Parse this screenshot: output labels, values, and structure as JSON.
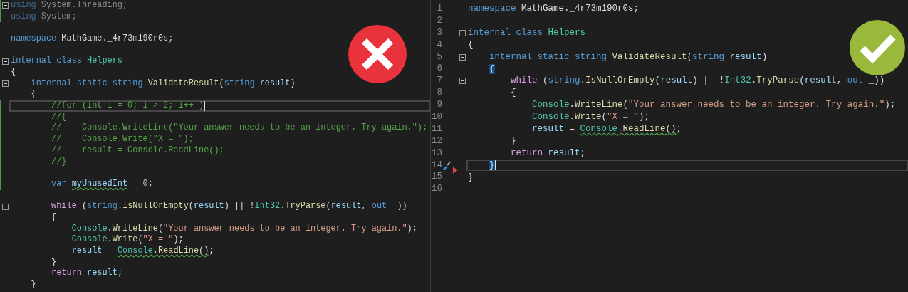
{
  "before": {
    "passed": false,
    "lines": [
      {
        "fold": true,
        "changed": true,
        "tokens": [
          {
            "text": "using",
            "kind": "dim_keyword"
          },
          {
            "text": " System.Threading;",
            "kind": "dim"
          }
        ]
      },
      {
        "changed": true,
        "tokens": [
          {
            "text": "using",
            "kind": "dim_keyword"
          },
          {
            "text": " System;",
            "kind": "dim"
          }
        ]
      },
      {
        "kind": "blank"
      },
      {
        "tokens": [
          {
            "text": "namespace",
            "kind": "keyword"
          },
          {
            "text": " MathGame._4r73m190r0s;",
            "kind": "plain"
          }
        ]
      },
      {
        "kind": "blank"
      },
      {
        "fold": true,
        "tokens": [
          {
            "text": "internal class ",
            "kind": "keyword"
          },
          {
            "text": "Helpers",
            "kind": "type"
          }
        ]
      },
      {
        "tokens": [
          {
            "text": "{",
            "kind": "plain"
          }
        ]
      },
      {
        "fold": true,
        "tokens": [
          {
            "text": "    internal static string ",
            "kind": "keyword"
          },
          {
            "text": "ValidateResult",
            "kind": "method"
          },
          {
            "text": "(",
            "kind": "plain"
          },
          {
            "text": "string ",
            "kind": "keyword"
          },
          {
            "text": "result",
            "kind": "variable"
          },
          {
            "text": ")",
            "kind": "plain"
          }
        ]
      },
      {
        "tokens": [
          {
            "text": "    {",
            "kind": "plain"
          }
        ]
      },
      {
        "current": true,
        "changed": true,
        "tokens": [
          {
            "text": "        //for (int i = 0; i > 2; i++ )",
            "kind": "comment"
          }
        ]
      },
      {
        "changed": true,
        "tokens": [
          {
            "text": "        //{",
            "kind": "comment"
          }
        ]
      },
      {
        "changed": true,
        "tokens": [
          {
            "text": "        //    Console.WriteLine(\"Your answer needs to be an integer. Try again.\");",
            "kind": "comment"
          }
        ]
      },
      {
        "changed": true,
        "tokens": [
          {
            "text": "        //    Console.Write(\"X = \");",
            "kind": "comment"
          }
        ]
      },
      {
        "changed": true,
        "tokens": [
          {
            "text": "        //    result = Console.ReadLine();",
            "kind": "comment"
          }
        ]
      },
      {
        "changed": true,
        "tokens": [
          {
            "text": "        //}",
            "kind": "comment"
          }
        ]
      },
      {
        "kind": "blank",
        "changed": true
      },
      {
        "changed": true,
        "tokens": [
          {
            "text": "        var ",
            "kind": "keyword"
          },
          {
            "text": "myUnusedInt",
            "kind": "variable",
            "squiggle": true
          },
          {
            "text": " = ",
            "kind": "plain"
          },
          {
            "text": "0",
            "kind": "number"
          },
          {
            "text": ";",
            "kind": "plain"
          }
        ]
      },
      {
        "kind": "blank"
      },
      {
        "fold": true,
        "tokens": [
          {
            "text": "        while",
            "kind": "control"
          },
          {
            "text": " (",
            "kind": "plain"
          },
          {
            "text": "string",
            "kind": "keyword"
          },
          {
            "text": ".",
            "kind": "plain"
          },
          {
            "text": "IsNullOrEmpty",
            "kind": "method"
          },
          {
            "text": "(",
            "kind": "plain"
          },
          {
            "text": "result",
            "kind": "variable"
          },
          {
            "text": ") || !",
            "kind": "plain"
          },
          {
            "text": "Int32",
            "kind": "type"
          },
          {
            "text": ".",
            "kind": "plain"
          },
          {
            "text": "TryParse",
            "kind": "method"
          },
          {
            "text": "(",
            "kind": "plain"
          },
          {
            "text": "result",
            "kind": "variable"
          },
          {
            "text": ", ",
            "kind": "plain"
          },
          {
            "text": "out",
            "kind": "keyword"
          },
          {
            "text": " _))",
            "kind": "plain"
          }
        ]
      },
      {
        "tokens": [
          {
            "text": "        {",
            "kind": "plain"
          }
        ]
      },
      {
        "tokens": [
          {
            "text": "            Console",
            "kind": "type"
          },
          {
            "text": ".",
            "kind": "plain"
          },
          {
            "text": "WriteLine",
            "kind": "method"
          },
          {
            "text": "(",
            "kind": "plain"
          },
          {
            "text": "\"Your answer needs to be an integer. Try again.\"",
            "kind": "string"
          },
          {
            "text": ");",
            "kind": "plain"
          }
        ]
      },
      {
        "tokens": [
          {
            "text": "            Console",
            "kind": "type"
          },
          {
            "text": ".",
            "kind": "plain"
          },
          {
            "text": "Write",
            "kind": "method"
          },
          {
            "text": "(",
            "kind": "plain"
          },
          {
            "text": "\"X = \"",
            "kind": "string"
          },
          {
            "text": ");",
            "kind": "plain"
          }
        ]
      },
      {
        "tokens": [
          {
            "text": "            result",
            "kind": "variable"
          },
          {
            "text": " = ",
            "kind": "plain"
          },
          {
            "text": "Console",
            "kind": "type",
            "squiggle": true
          },
          {
            "text": ".",
            "kind": "plain",
            "squiggle": true
          },
          {
            "text": "ReadLine",
            "kind": "method",
            "squiggle": true
          },
          {
            "text": "()",
            "kind": "plain",
            "squiggle": true
          },
          {
            "text": ";",
            "kind": "plain"
          }
        ]
      },
      {
        "tokens": [
          {
            "text": "        }",
            "kind": "plain"
          }
        ]
      },
      {
        "tokens": [
          {
            "text": "        return ",
            "kind": "control"
          },
          {
            "text": "result",
            "kind": "variable"
          },
          {
            "text": ";",
            "kind": "plain"
          }
        ]
      },
      {
        "tokens": [
          {
            "text": "    }",
            "kind": "plain"
          }
        ]
      }
    ]
  },
  "after": {
    "passed": true,
    "lines": [
      {
        "number": "1",
        "tokens": [
          {
            "text": "namespace",
            "kind": "keyword"
          },
          {
            "text": " MathGame._4r73m190r0s;",
            "kind": "plain"
          }
        ]
      },
      {
        "number": "2"
      },
      {
        "number": "3",
        "fold": true,
        "tokens": [
          {
            "text": "internal class ",
            "kind": "keyword"
          },
          {
            "text": "Helpers",
            "kind": "type"
          }
        ]
      },
      {
        "number": "4",
        "tokens": [
          {
            "text": "{",
            "kind": "plain"
          }
        ]
      },
      {
        "number": "5",
        "fold": true,
        "tokens": [
          {
            "text": "    internal static string ",
            "kind": "keyword"
          },
          {
            "text": "ValidateResult",
            "kind": "method"
          },
          {
            "text": "(",
            "kind": "plain"
          },
          {
            "text": "string ",
            "kind": "keyword"
          },
          {
            "text": "result",
            "kind": "variable"
          },
          {
            "text": ")",
            "kind": "plain"
          }
        ]
      },
      {
        "number": "6",
        "tokens": [
          {
            "text": "    {",
            "kind": "plain",
            "match": true
          }
        ]
      },
      {
        "number": "7",
        "fold": true,
        "tokens": [
          {
            "text": "        while",
            "kind": "control"
          },
          {
            "text": " (",
            "kind": "plain"
          },
          {
            "text": "string",
            "kind": "keyword"
          },
          {
            "text": ".",
            "kind": "plain"
          },
          {
            "text": "IsNullOrEmpty",
            "kind": "method"
          },
          {
            "text": "(",
            "kind": "plain"
          },
          {
            "text": "result",
            "kind": "variable"
          },
          {
            "text": ") || !",
            "kind": "plain"
          },
          {
            "text": "Int32",
            "kind": "type"
          },
          {
            "text": ".",
            "kind": "plain"
          },
          {
            "text": "TryParse",
            "kind": "method"
          },
          {
            "text": "(",
            "kind": "plain"
          },
          {
            "text": "result",
            "kind": "variable"
          },
          {
            "text": ", ",
            "kind": "plain"
          },
          {
            "text": "out",
            "kind": "keyword"
          },
          {
            "text": " _))",
            "kind": "plain"
          }
        ]
      },
      {
        "number": "8",
        "tokens": [
          {
            "text": "        {",
            "kind": "plain"
          }
        ]
      },
      {
        "number": "9",
        "tokens": [
          {
            "text": "            Console",
            "kind": "type"
          },
          {
            "text": ".",
            "kind": "plain"
          },
          {
            "text": "WriteLine",
            "kind": "method"
          },
          {
            "text": "(",
            "kind": "plain"
          },
          {
            "text": "\"Your answer needs to be an integer. Try again.\"",
            "kind": "string"
          },
          {
            "text": ");",
            "kind": "plain"
          }
        ]
      },
      {
        "number": "10",
        "tokens": [
          {
            "text": "            Console",
            "kind": "type"
          },
          {
            "text": ".",
            "kind": "plain"
          },
          {
            "text": "Write",
            "kind": "method"
          },
          {
            "text": "(",
            "kind": "plain"
          },
          {
            "text": "\"X = \"",
            "kind": "string"
          },
          {
            "text": ");",
            "kind": "plain"
          }
        ]
      },
      {
        "number": "11",
        "tokens": [
          {
            "text": "            result",
            "kind": "variable"
          },
          {
            "text": " = ",
            "kind": "plain"
          },
          {
            "text": "Console",
            "kind": "type",
            "squiggle": true
          },
          {
            "text": ".",
            "kind": "plain",
            "squiggle": true
          },
          {
            "text": "ReadLine",
            "kind": "method",
            "squiggle": true
          },
          {
            "text": "()",
            "kind": "plain",
            "squiggle": true
          },
          {
            "text": ";",
            "kind": "plain"
          }
        ]
      },
      {
        "number": "12",
        "tokens": [
          {
            "text": "        }",
            "kind": "plain"
          }
        ]
      },
      {
        "number": "13",
        "tokens": [
          {
            "text": "        return ",
            "kind": "control"
          },
          {
            "text": "result",
            "kind": "variable"
          },
          {
            "text": ";",
            "kind": "plain"
          }
        ]
      },
      {
        "number": "14",
        "current": true,
        "quick_fix": true,
        "tokens": [
          {
            "text": "    }",
            "kind": "plain",
            "match": true
          }
        ]
      },
      {
        "number": "15",
        "tokens": [
          {
            "text": "}",
            "kind": "plain"
          }
        ]
      },
      {
        "number": "16"
      }
    ]
  }
}
